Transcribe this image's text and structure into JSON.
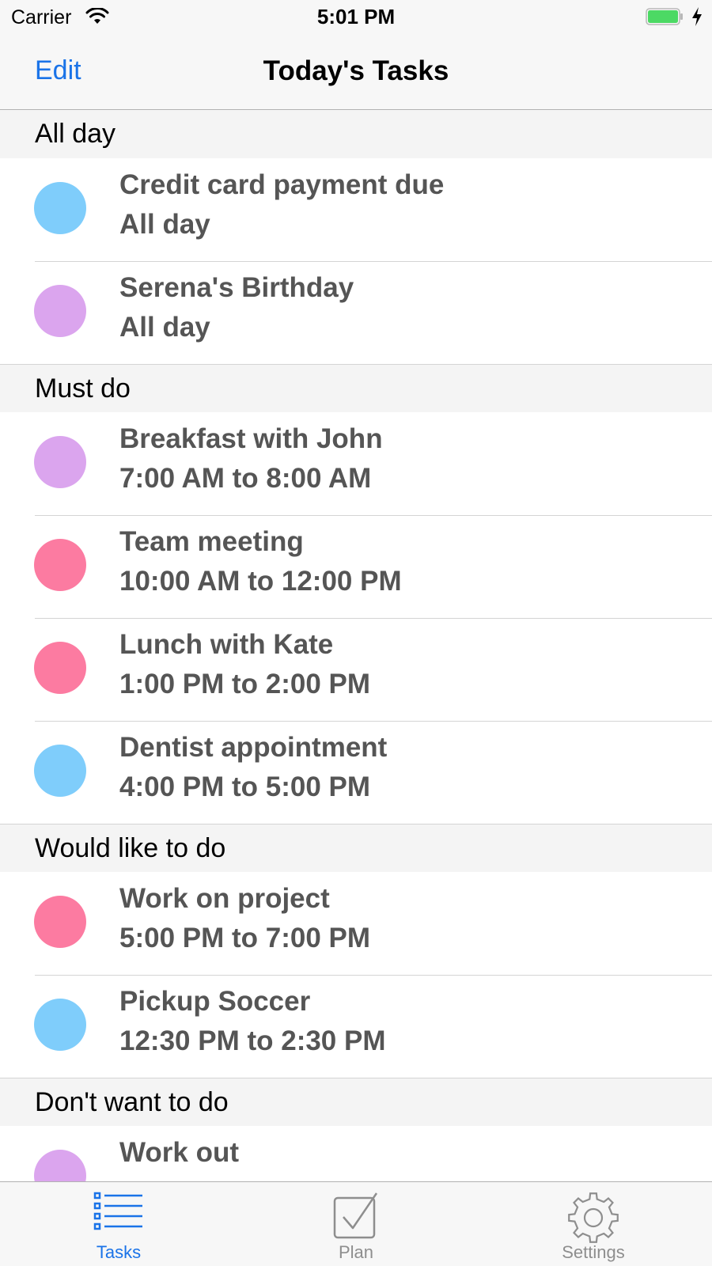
{
  "status_bar": {
    "carrier": "Carrier",
    "time": "5:01 PM",
    "battery_color": "#4cd964"
  },
  "nav": {
    "edit_label": "Edit",
    "title": "Today's Tasks",
    "accent_color": "#1a73e8"
  },
  "sections": [
    {
      "title": "All day",
      "items": [
        {
          "title": "Credit card payment due",
          "subtitle": "All day",
          "dot_color": "#7fcdfb"
        },
        {
          "title": "Serena's Birthday",
          "subtitle": "All day",
          "dot_color": "#dba5ee"
        }
      ]
    },
    {
      "title": "Must do",
      "items": [
        {
          "title": "Breakfast with John",
          "subtitle": "7:00 AM to 8:00 AM",
          "dot_color": "#dba5ee"
        },
        {
          "title": "Team meeting",
          "subtitle": "10:00 AM to 12:00 PM",
          "dot_color": "#fc7ba1"
        },
        {
          "title": "Lunch with Kate",
          "subtitle": "1:00 PM to 2:00 PM",
          "dot_color": "#fc7ba1"
        },
        {
          "title": "Dentist appointment",
          "subtitle": "4:00 PM to 5:00 PM",
          "dot_color": "#7fcdfb"
        }
      ]
    },
    {
      "title": "Would like to do",
      "items": [
        {
          "title": "Work on project",
          "subtitle": "5:00 PM to 7:00 PM",
          "dot_color": "#fc7ba1"
        },
        {
          "title": "Pickup Soccer",
          "subtitle": "12:30 PM to 2:30 PM",
          "dot_color": "#7fcdfb"
        }
      ]
    },
    {
      "title": "Don't want to do",
      "items": [
        {
          "title": "Work out",
          "subtitle": "",
          "dot_color": "#dba5ee"
        }
      ]
    }
  ],
  "tabs": [
    {
      "label": "Tasks",
      "icon": "list-icon",
      "active": true
    },
    {
      "label": "Plan",
      "icon": "checkbox-icon",
      "active": false
    },
    {
      "label": "Settings",
      "icon": "gear-icon",
      "active": false
    }
  ]
}
